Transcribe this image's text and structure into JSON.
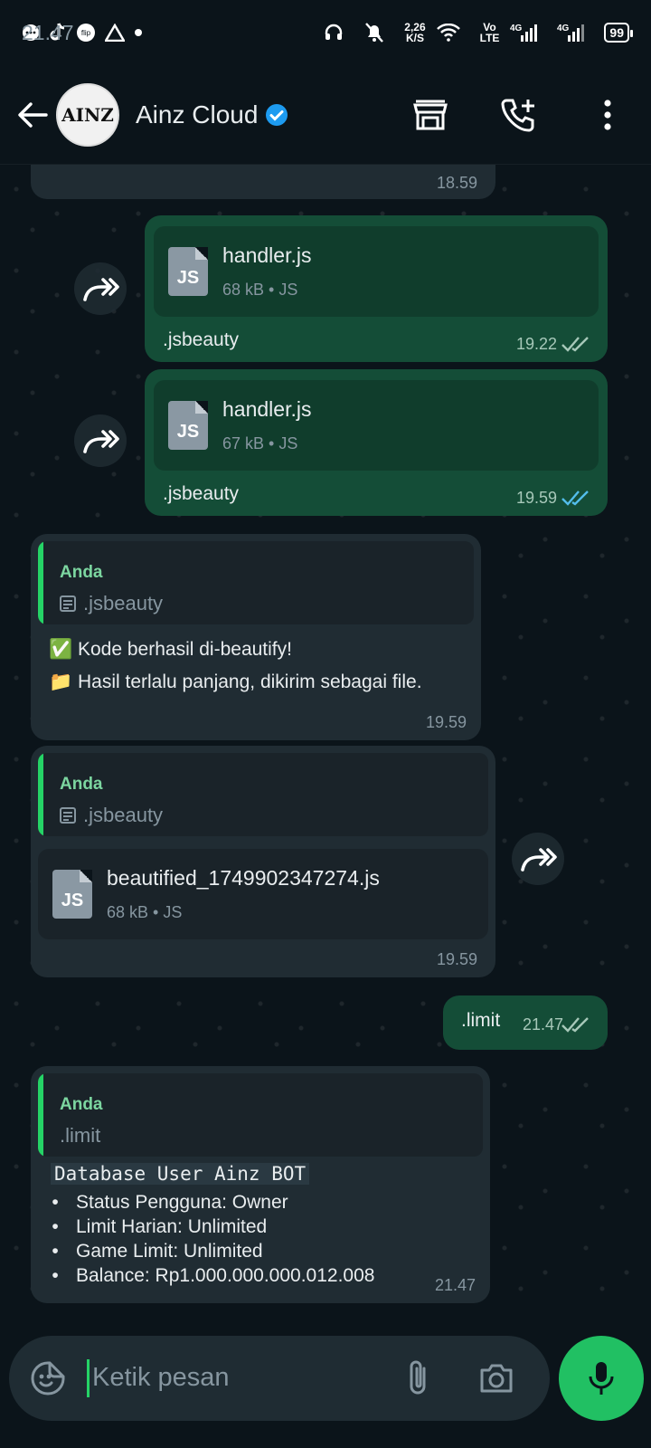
{
  "status_bar": {
    "time": "21.47",
    "net_speed_value": "2,26",
    "net_speed_unit": "K/S",
    "volte": "Vo\nLTE",
    "signal1": "4G",
    "signal2": "4G",
    "battery": "99"
  },
  "header": {
    "contact_name": "Ainz Cloud",
    "avatar_text": "AINZ"
  },
  "messages": {
    "m0": {
      "time": "18.59"
    },
    "m1": {
      "file_name": "handler.js",
      "file_type": "JS",
      "file_meta": "68 kB • JS",
      "caption": ".jsbeauty",
      "time": "19.22",
      "read": false
    },
    "m2": {
      "file_name": "handler.js",
      "file_type": "JS",
      "file_meta": "67 kB • JS",
      "caption": ".jsbeauty",
      "time": "19.59",
      "read": true
    },
    "m3": {
      "quote_author": "Anda",
      "quote_text": ".jsbeauty",
      "line1_emoji": "✅",
      "line1": "Kode berhasil di-beautify!",
      "line2_emoji": "📁",
      "line2": "Hasil terlalu panjang, dikirim sebagai file.",
      "time": "19.59"
    },
    "m4": {
      "quote_author": "Anda",
      "quote_text": ".jsbeauty",
      "file_name": "beautified_1749902347274.js",
      "file_type": "JS",
      "file_meta": "68 kB • JS",
      "time": "19.59"
    },
    "m5": {
      "text": ".limit",
      "time": "21.47"
    },
    "m6": {
      "quote_author": "Anda",
      "quote_text": ".limit",
      "title": "Database User Ainz BOT",
      "bullets": [
        "Status Pengguna: Owner",
        "Limit Harian: Unlimited",
        "Game Limit: Unlimited",
        "Balance: Rp1.000.000.000.012.008"
      ],
      "bullet_symbol": "•",
      "time": "21.47"
    }
  },
  "input": {
    "placeholder": "Ketik pesan"
  },
  "colors": {
    "background": "#0b141a",
    "incoming_bubble": "#202c33",
    "outgoing_bubble": "#144d37",
    "accent_green": "#21c063",
    "read_ticks": "#53bdeb"
  }
}
